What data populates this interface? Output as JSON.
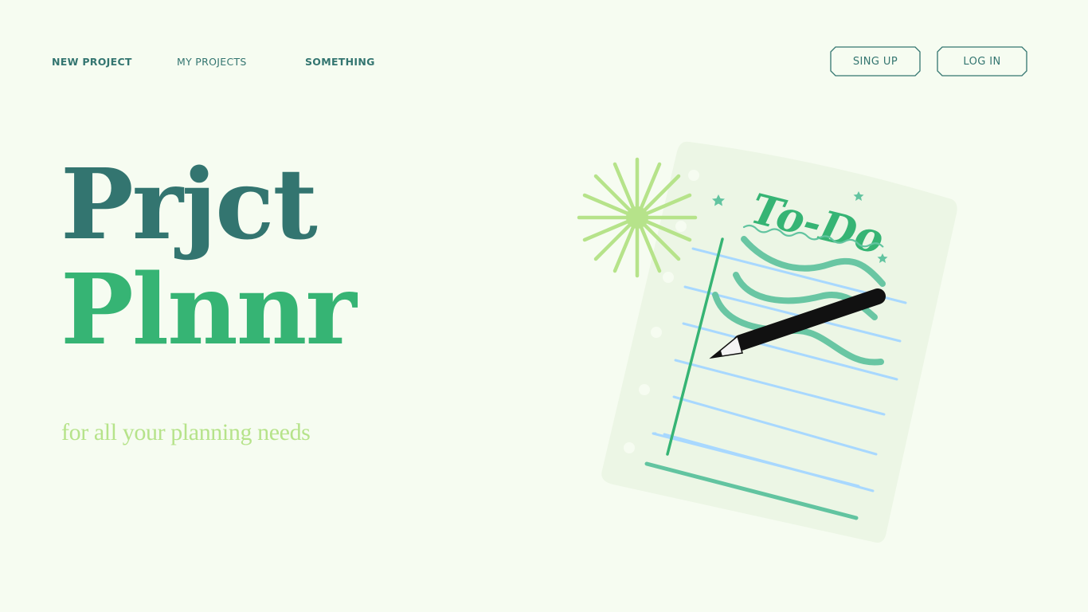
{
  "nav": {
    "links": [
      "NEW PROJECT",
      "MY PROJECTS",
      "SOMETHING"
    ]
  },
  "auth": {
    "signup_label": "SING UP",
    "login_label": "LOG IN"
  },
  "hero": {
    "title_line1": "Prjct",
    "title_line2": "Plnnr",
    "tagline": "for all your planning needs"
  },
  "illustration": {
    "todo_text": "To-Do",
    "icons": [
      "notepad-icon",
      "pencil-icon",
      "starburst-icon",
      "star-icon"
    ]
  },
  "colors": {
    "background": "#f6fcf1",
    "dark_teal": "#337570",
    "green": "#36b474",
    "light_green": "#b6e38a",
    "paper": "#ecf6e5",
    "rule_blue": "#a8d8ff",
    "scribble": "#62c4a0"
  }
}
